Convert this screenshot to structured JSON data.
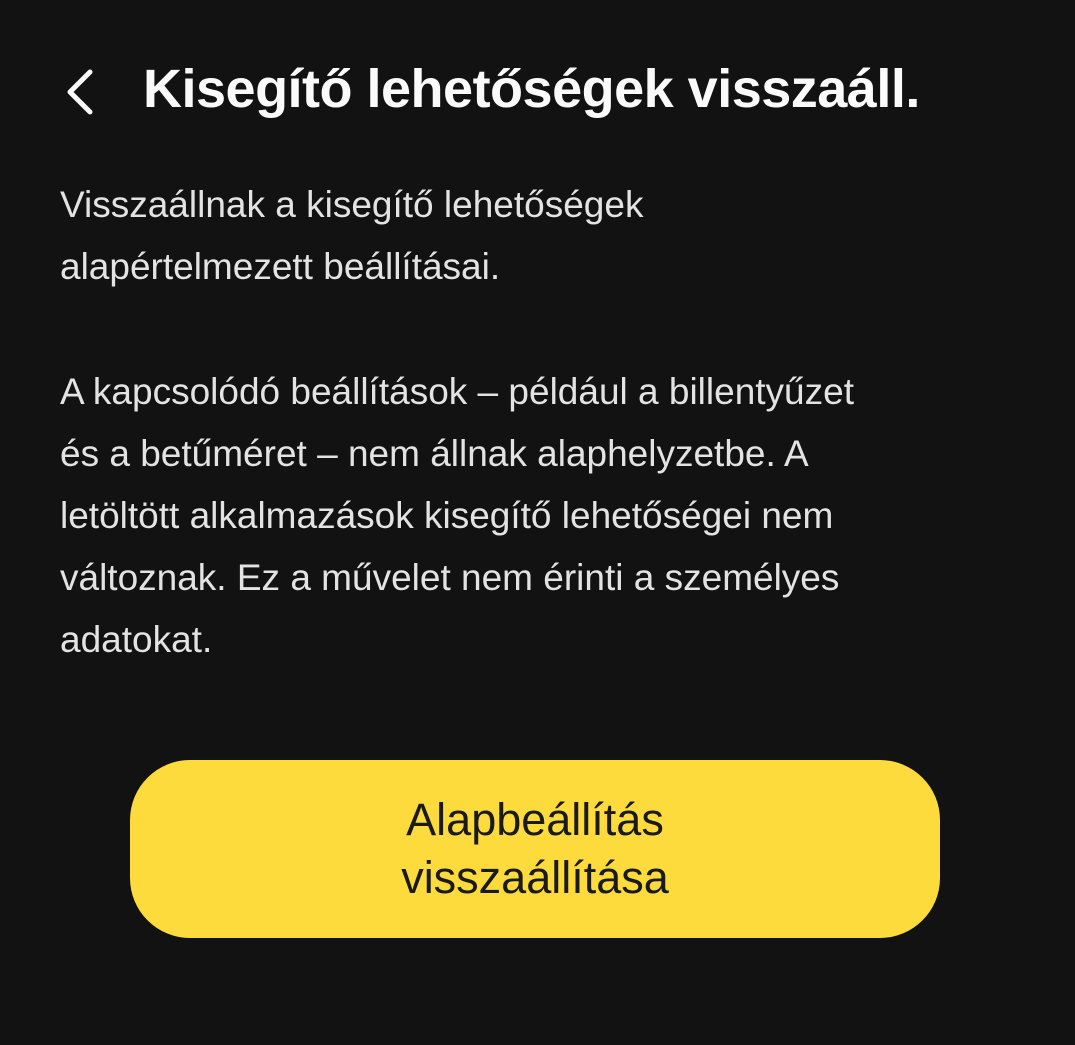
{
  "header": {
    "back_icon": "chevron-left-icon",
    "title": "Kisegítő lehetőségek visszaáll."
  },
  "description": {
    "paragraph1_lines": [
      "Visszaállnak a kisegítő lehetőségek",
      "alapértelmezett beállításai."
    ],
    "paragraph2_lines": [
      "A kapcsolódó beállítások – például a billentyűzet",
      "és a betűméret – nem állnak alaphelyzetbe. A",
      "letöltött alkalmazások kisegítő lehetőségei nem",
      "változnak. Ez a művelet nem érinti a személyes",
      "adatokat."
    ]
  },
  "reset_button": {
    "label_lines": [
      "Alapbeállítás",
      "visszaállítása"
    ]
  },
  "colors": {
    "background": "#121212",
    "accent": "#fddb3d"
  }
}
